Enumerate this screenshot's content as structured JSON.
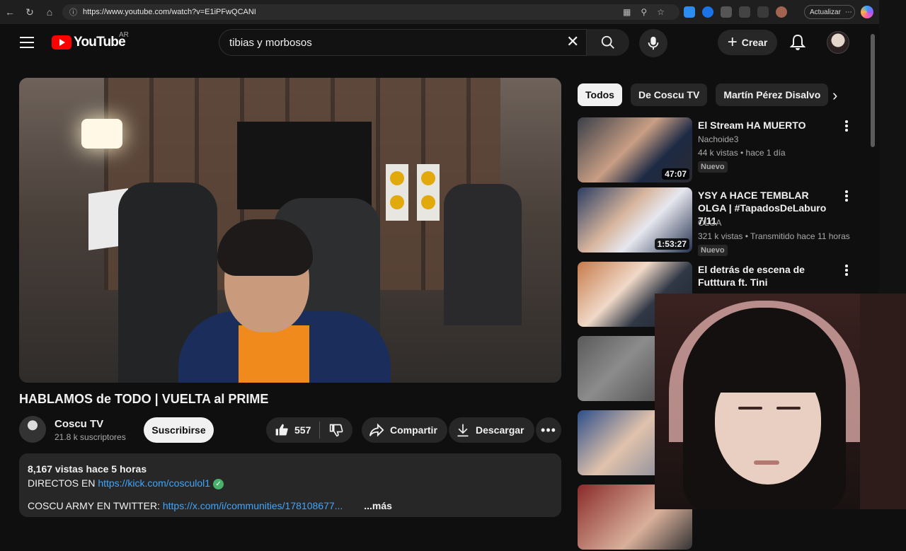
{
  "browser": {
    "url": "https://www.youtube.com/watch?v=E1iPFwQCANI",
    "update_label": "Actualizar"
  },
  "header": {
    "logo_text": "YouTube",
    "country": "AR",
    "search_query": "tibias y morbosos",
    "create_label": "Crear"
  },
  "video": {
    "title": "HABLAMOS de TODO | VUELTA al PRIME",
    "channel": "Coscu TV",
    "subscribers": "21.8 k suscriptores",
    "subscribe_label": "Suscribirse",
    "likes": "557",
    "share_label": "Compartir",
    "download_label": "Descargar"
  },
  "description": {
    "stats": "8,167 vistas  hace 5 horas",
    "line2_prefix": "DIRECTOS EN ",
    "line2_link": "https://kick.com/cosculol1",
    "line3_prefix": "COSCU ARMY EN TWITTER: ",
    "line3_link": "https://x.com/i/communities/178108677...",
    "more_label": "...más"
  },
  "chips": [
    "Todos",
    "De Coscu TV",
    "Martín Pérez Disalvo"
  ],
  "recommendations": [
    {
      "title": "El Stream HA MUERTO",
      "channel": "Nachoide3",
      "meta": "44 k vistas • hace 1 día",
      "badge": "Nuevo",
      "duration": "47:07"
    },
    {
      "title": "YSY A HACE TEMBLAR OLGA | #TapadosDeLaburo 7/11",
      "channel": "OLGA",
      "meta": "321 k vistas • Transmitido hace 11 horas",
      "badge": "Nuevo",
      "duration": "1:53:27"
    },
    {
      "title": "El detrás de escena de Futttura ft. Tini",
      "channel": "",
      "meta": "",
      "badge": "",
      "duration": ""
    }
  ],
  "colors": {
    "background": "#0f0f0f",
    "accent_red": "#ff0000",
    "link_blue": "#3ea6ff",
    "chip_bg": "#272727"
  }
}
